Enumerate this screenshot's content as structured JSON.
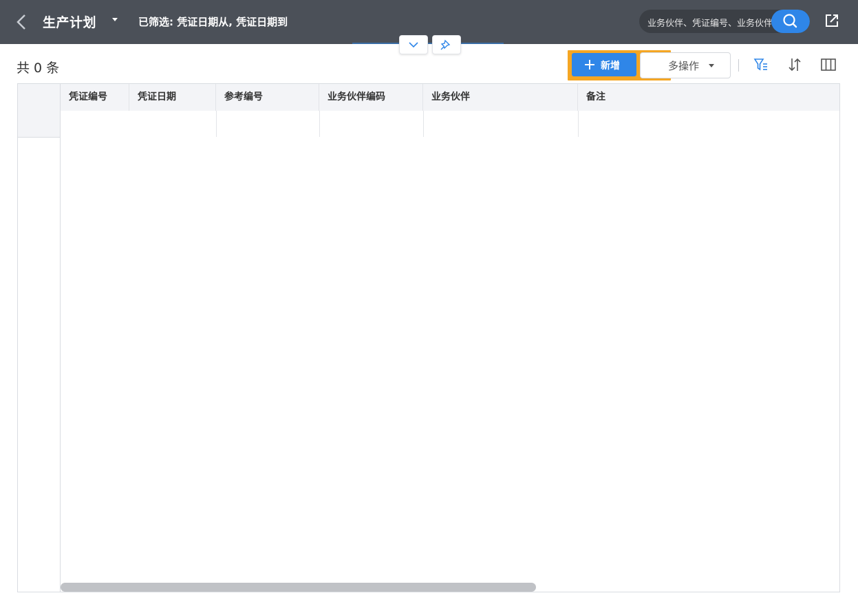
{
  "header": {
    "title": "生产计划",
    "filter_summary": "已筛选: 凭证日期从, 凭证日期到",
    "search_placeholder": "业务伙伴、凭证编号、业务伙伴编码"
  },
  "toolbar": {
    "record_count": "共 0 条",
    "add_label": "新增",
    "more_ops_label": "多操作",
    "highlight_number": "1"
  },
  "table": {
    "columns": [
      "凭证编号",
      "凭证日期",
      "参考编号",
      "业务伙伴编码",
      "业务伙伴",
      "备注"
    ],
    "rows": []
  },
  "colors": {
    "header_bg": "#4b5058",
    "accent": "#2f86e8",
    "highlight": "#f5a623"
  },
  "icons": [
    "chevron-left-icon",
    "caret-down-icon",
    "search-icon",
    "share-icon",
    "chevron-down-icon",
    "pin-icon",
    "plus-icon",
    "filter-icon",
    "sort-icon",
    "columns-icon"
  ]
}
